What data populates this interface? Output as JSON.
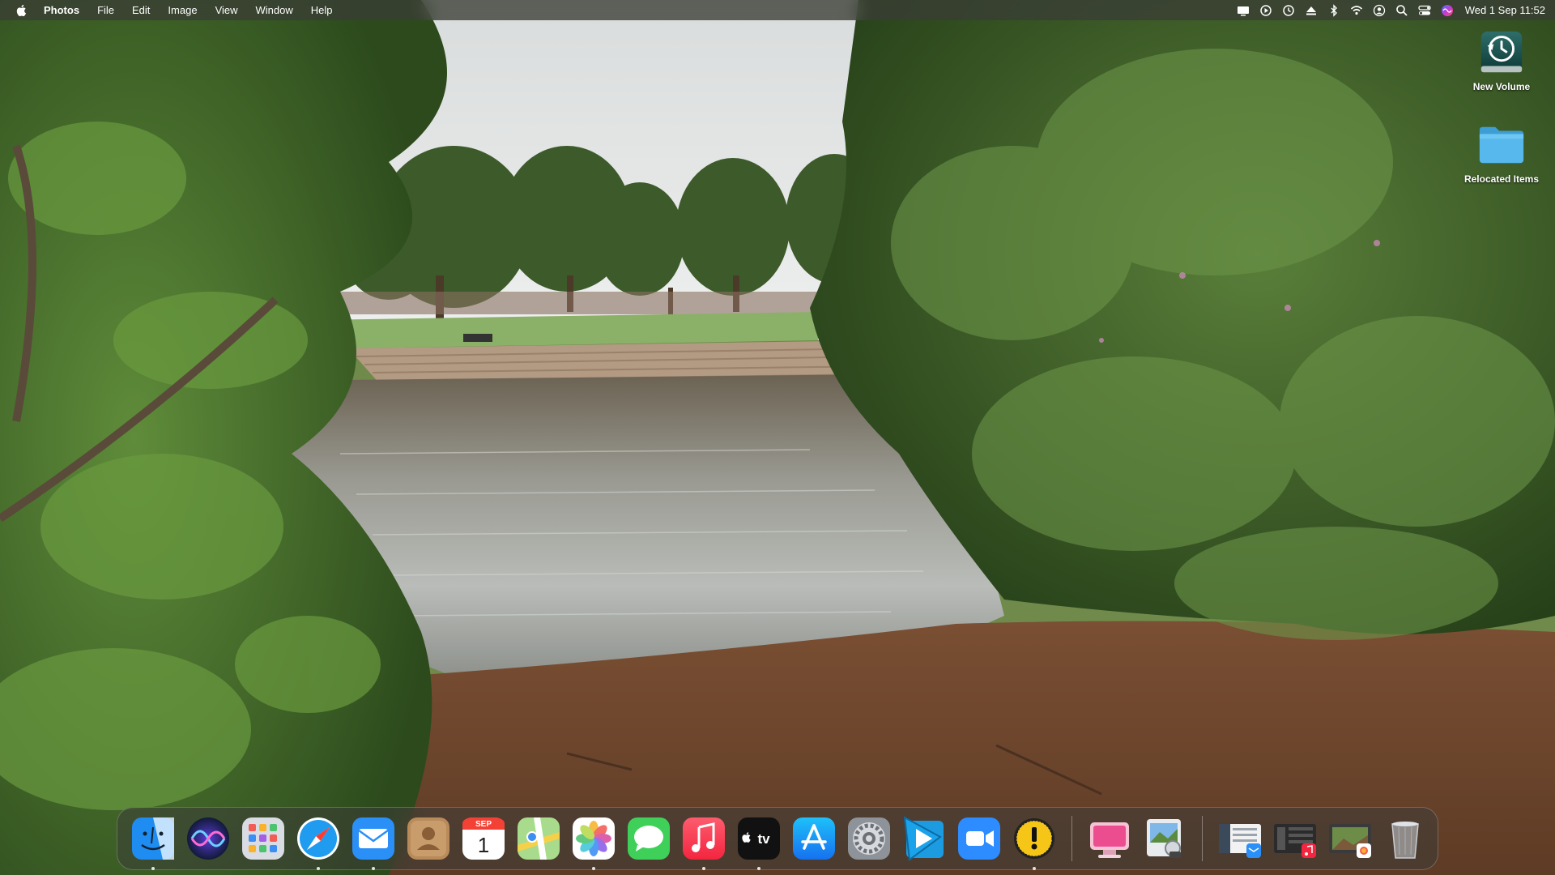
{
  "menubar": {
    "app_name": "Photos",
    "menus": [
      "File",
      "Edit",
      "Image",
      "View",
      "Window",
      "Help"
    ],
    "status_icons": [
      "display-icon",
      "play-circle-icon",
      "time-machine-icon",
      "eject-icon",
      "bluetooth-icon",
      "wifi-icon",
      "user-icon",
      "search-icon",
      "control-center-icon",
      "siri-icon"
    ],
    "clock": "Wed 1 Sep  11:52"
  },
  "desktop": {
    "icons": [
      {
        "label": "New Volume",
        "icon": "time-machine-drive-icon"
      },
      {
        "label": "Relocated Items",
        "icon": "folder-icon"
      }
    ]
  },
  "dock": {
    "apps": [
      {
        "name": "Finder",
        "running": true
      },
      {
        "name": "Siri",
        "running": false
      },
      {
        "name": "Launchpad",
        "running": false
      },
      {
        "name": "Safari",
        "running": true
      },
      {
        "name": "Mail",
        "running": true
      },
      {
        "name": "Contacts",
        "running": false
      },
      {
        "name": "Calendar",
        "running": false,
        "month": "SEP",
        "day": "1"
      },
      {
        "name": "Maps",
        "running": false
      },
      {
        "name": "Photos",
        "running": true
      },
      {
        "name": "Messages",
        "running": false
      },
      {
        "name": "Music",
        "running": true
      },
      {
        "name": "TV",
        "running": true,
        "label": "tv"
      },
      {
        "name": "App Store",
        "running": false
      },
      {
        "name": "System Preferences",
        "running": false
      },
      {
        "name": "Prime Video",
        "running": false
      },
      {
        "name": "Zoom",
        "running": false
      },
      {
        "name": "Console",
        "running": true
      }
    ],
    "recent": [
      {
        "name": "CleanMyMac"
      },
      {
        "name": "Preview"
      }
    ],
    "minimized": [
      {
        "name": "Mail window"
      },
      {
        "name": "Music window"
      },
      {
        "name": "Photos window"
      },
      {
        "name": "Trash"
      }
    ]
  },
  "colors": {
    "menubar_bg": "#3a3e34",
    "folder_blue": "#4fb3e8",
    "dock_bg": "#3c3c38"
  }
}
